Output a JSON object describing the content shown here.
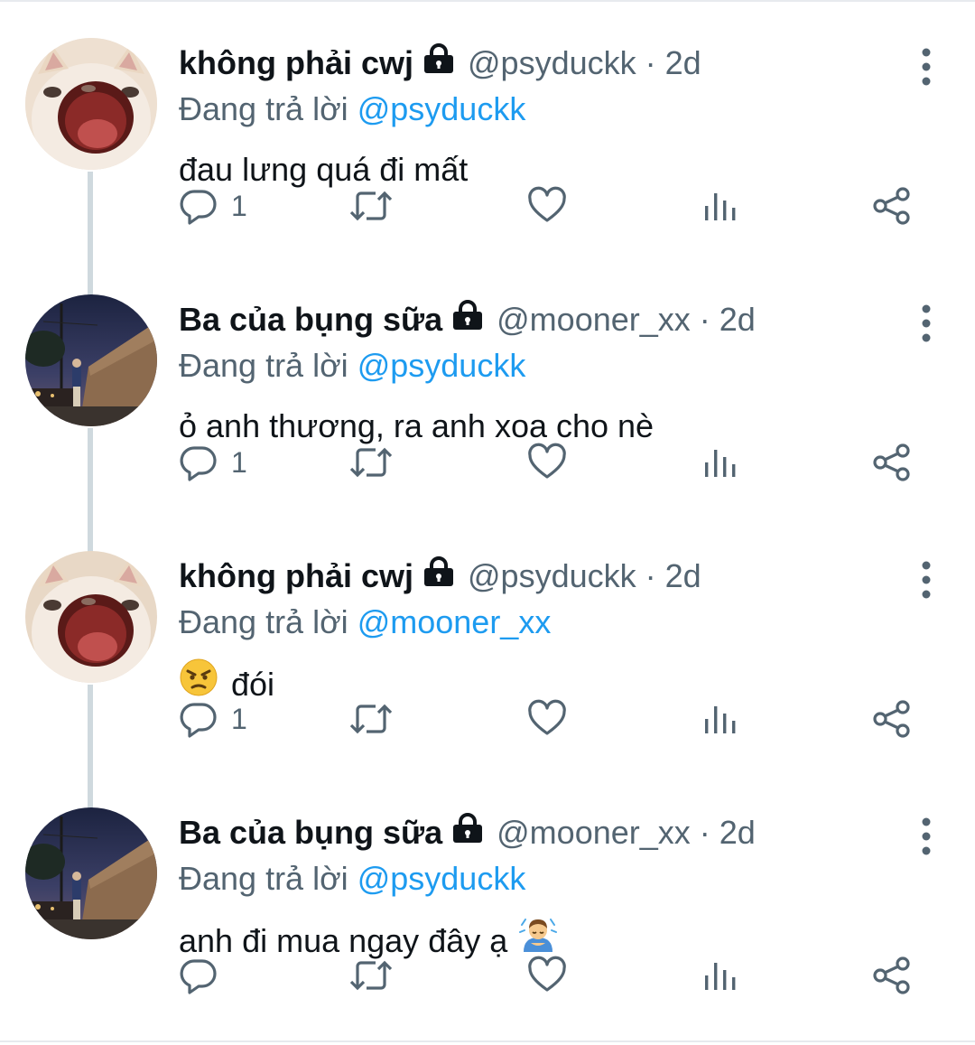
{
  "tweets": [
    {
      "author_name": "không phải cwj",
      "handle": "@psyduckk",
      "time": "2d",
      "reply_prefix": "Đang trả lời",
      "reply_to": "@psyduckk",
      "text": "đau lưng quá đi mất",
      "text_emoji_before": "",
      "text_emoji_after": "",
      "avatar": "cat-avatar",
      "reply_count": "1"
    },
    {
      "author_name": "Ba của bụng sữa",
      "handle": "@mooner_xx",
      "time": "2d",
      "reply_prefix": "Đang trả lời",
      "reply_to": "@psyduckk",
      "text": "ỏ anh thương, ra anh xoa cho nè",
      "text_emoji_before": "",
      "text_emoji_after": "",
      "avatar": "street-photo-avatar",
      "reply_count": "1"
    },
    {
      "author_name": "không phải cwj",
      "handle": "@psyduckk",
      "time": "2d",
      "reply_prefix": "Đang trả lời",
      "reply_to": "@mooner_xx",
      "text": "đói",
      "text_emoji_before": "angry-face",
      "text_emoji_after": "",
      "avatar": "cat-avatar",
      "reply_count": "1"
    },
    {
      "author_name": "Ba của bụng sữa",
      "handle": "@mooner_xx",
      "time": "2d",
      "reply_prefix": "Đang trả lời",
      "reply_to": "@psyduckk",
      "text": "anh đi mua ngay đây ạ",
      "text_emoji_before": "",
      "text_emoji_after": "bowing-person",
      "avatar": "street-photo-avatar",
      "reply_count": ""
    }
  ],
  "icons": {
    "reply": "reply-icon",
    "retweet": "retweet-icon",
    "like": "like-icon",
    "views": "views-icon",
    "share": "share-icon",
    "more": "more-icon",
    "lock": "lock-icon"
  },
  "colors": {
    "link": "#1d9bf0",
    "secondary": "#536471",
    "primary": "#0f1419",
    "thread_line": "#cfd9de"
  }
}
